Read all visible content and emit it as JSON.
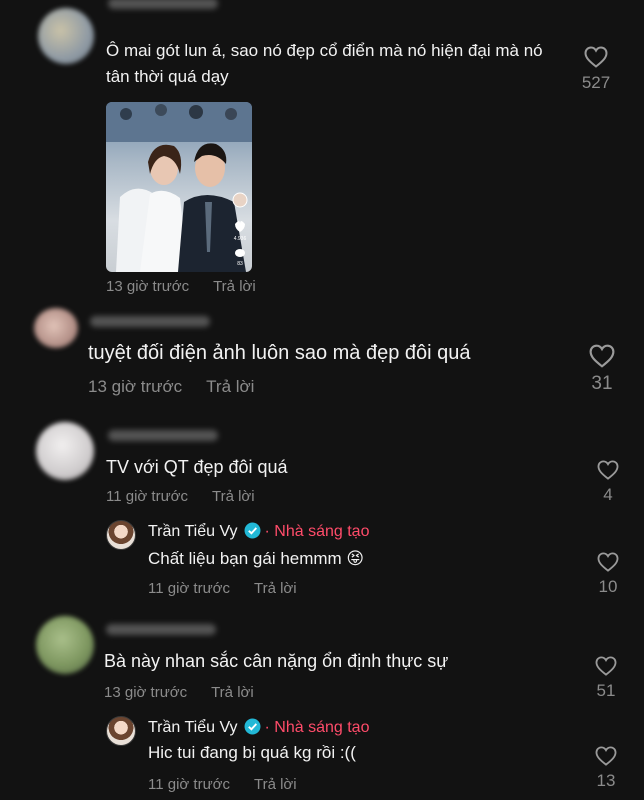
{
  "comments": [
    {
      "text": "Ô mai gót lun á, sao nó đẹp cổ điển mà nó hiện đại mà nó tân thời quá dạy",
      "time": "13 giờ trước",
      "reply_label": "Trả lời",
      "likes": "527",
      "avatar_color": "#9aa0a8",
      "has_image": true,
      "image_stats": {
        "likes": "4.936",
        "comments": "83"
      }
    },
    {
      "text": "tuyệt đối điện ảnh luôn sao mà đẹp đôi quá",
      "time": "13 giờ trước",
      "reply_label": "Trả lời",
      "likes": "31",
      "avatar_color": "#c7a9a0"
    },
    {
      "text": "TV với QT đẹp đôi quá",
      "time": "11 giờ trước",
      "reply_label": "Trả lời",
      "likes": "4",
      "avatar_color": "#cfcfd0",
      "reply": {
        "author": "Trần Tiểu Vy",
        "badge": "Nhà sáng tạo",
        "text": "Chất liệu bạn gái hemmm 😝",
        "time": "11 giờ trước",
        "reply_label": "Trả lời",
        "likes": "10"
      }
    },
    {
      "text": "Bà này nhan sắc cân nặng ổn định thực sự",
      "time": "13 giờ trước",
      "reply_label": "Trả lời",
      "likes": "51",
      "avatar_color": "#8aa36a",
      "reply": {
        "author": "Trần Tiểu Vy",
        "badge": "Nhà sáng tạo",
        "text": "Hic tui đang bị quá kg rồi :((",
        "time": "11 giờ trước",
        "reply_label": "Trả lời",
        "likes": "13"
      }
    }
  ],
  "colors": {
    "background": "#121212",
    "text": "#f2f2f2",
    "meta": "#8b8b8b",
    "creator_badge": "#ff4c6a",
    "verified": "#22b8d6"
  },
  "icons": {
    "like": "heart-outline-icon",
    "verified": "verified-check-icon"
  }
}
